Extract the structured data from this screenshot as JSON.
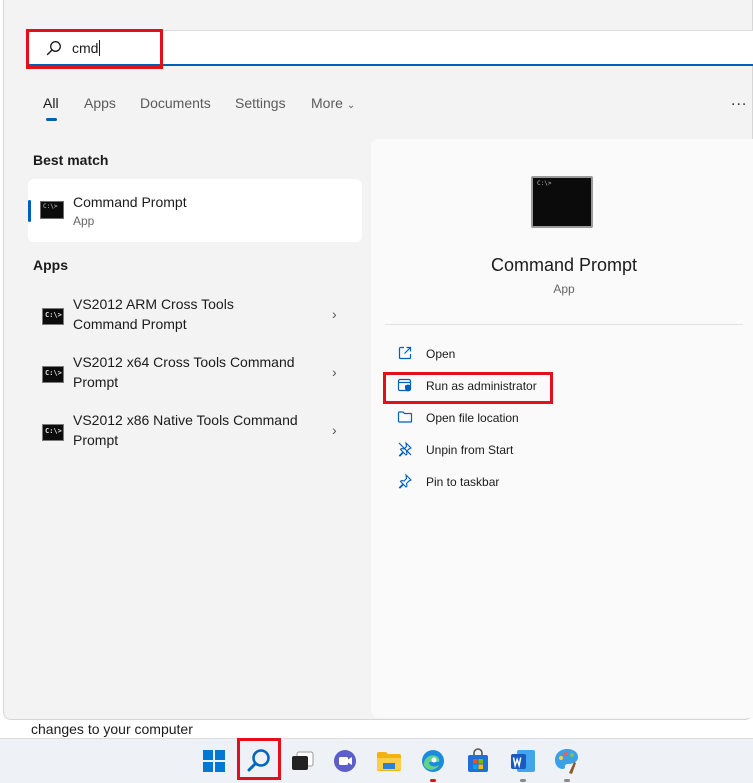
{
  "search": {
    "query": "cmd"
  },
  "tabs": [
    {
      "label": "All",
      "active": true
    },
    {
      "label": "Apps"
    },
    {
      "label": "Documents"
    },
    {
      "label": "Settings"
    },
    {
      "label": "More"
    }
  ],
  "more_options_label": "...",
  "best_match": {
    "heading": "Best match",
    "name": "Command Prompt",
    "type": "App"
  },
  "apps": {
    "heading": "Apps",
    "items": [
      {
        "line1": "VS2012 ARM Cross Tools",
        "line2": "Command Prompt"
      },
      {
        "line1": "VS2012 x64 Cross Tools Command",
        "line2": "Prompt"
      },
      {
        "line1": "VS2012 x86 Native Tools Command",
        "line2": "Prompt"
      }
    ]
  },
  "detail": {
    "title": "Command Prompt",
    "type": "App",
    "actions": [
      {
        "label": "Open",
        "icon": "open-icon"
      },
      {
        "label": "Run as administrator",
        "icon": "shield-icon"
      },
      {
        "label": "Open file location",
        "icon": "folder-icon"
      },
      {
        "label": "Unpin from Start",
        "icon": "unpin-icon"
      },
      {
        "label": "Pin to taskbar",
        "icon": "pin-icon"
      }
    ]
  },
  "background_text": "changes to your computer",
  "icon_glyph": "C:\\>",
  "colors": {
    "accent": "#005fb8",
    "highlight": "#e3101c"
  }
}
